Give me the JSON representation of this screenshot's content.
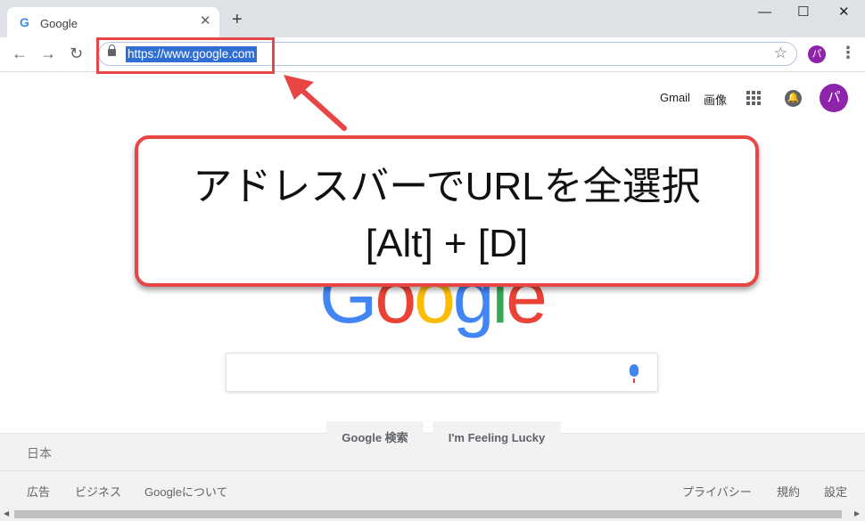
{
  "browser": {
    "tab_title": "Google",
    "tab_favicon": "G",
    "tab_close": "✕",
    "new_tab": "+",
    "window_controls": {
      "minimize": "—",
      "maximize": "☐",
      "close": "✕"
    },
    "nav": {
      "back": "←",
      "forward": "→",
      "reload": "↻"
    },
    "url": "https://www.google.com",
    "bookmark_icon": "☆",
    "profile_initial": "パ",
    "menu_icon": "⋮"
  },
  "callout": {
    "line1": "アドレスバーでURLを全選択",
    "line2": "[Alt] + [D]",
    "color": "#e84545"
  },
  "google": {
    "top_links": {
      "gmail": "Gmail",
      "images": "画像"
    },
    "account_initial": "パ",
    "notification_icon": "🔔",
    "logo_letters": [
      "G",
      "o",
      "o",
      "g",
      "l",
      "e"
    ],
    "logo_colors": [
      "#4285f4",
      "#ea4335",
      "#fbbc05",
      "#4285f4",
      "#34a853",
      "#ea4335"
    ],
    "search_button": "Google 検索",
    "lucky_button": "I'm Feeling Lucky"
  },
  "footer": {
    "country": "日本",
    "left_links": [
      "広告",
      "ビジネス",
      "Googleについて"
    ],
    "right_links": [
      "プライバシー",
      "規約",
      "設定"
    ]
  }
}
